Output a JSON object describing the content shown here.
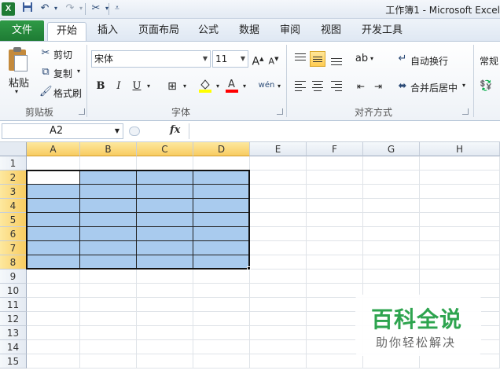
{
  "window": {
    "title": "工作簿1 - Microsoft Excel"
  },
  "quick_access": {
    "icons": [
      "excel-logo-icon",
      "save-icon",
      "undo-icon",
      "redo-icon",
      "tools-icon",
      "customize-icon"
    ]
  },
  "tabs": [
    {
      "label": "文件"
    },
    {
      "label": "开始"
    },
    {
      "label": "插入"
    },
    {
      "label": "页面布局"
    },
    {
      "label": "公式"
    },
    {
      "label": "数据"
    },
    {
      "label": "审阅"
    },
    {
      "label": "视图"
    },
    {
      "label": "开发工具"
    }
  ],
  "ribbon": {
    "clipboard": {
      "paste": "粘贴",
      "cut": "剪切",
      "copy": "复制",
      "format_painter": "格式刷",
      "group": "剪贴板"
    },
    "font": {
      "font_name": "宋体",
      "font_size": "11",
      "bold": "B",
      "italic": "I",
      "underline": "U",
      "group": "字体",
      "fill_color": "#ffff00",
      "font_color": "#ff0000"
    },
    "alignment": {
      "wrap_text": "自动换行",
      "merge_center": "合并后居中",
      "group": "对齐方式"
    },
    "number": {
      "format": "常规"
    }
  },
  "formula_bar": {
    "name_box": "A2",
    "fx": "fx",
    "formula": ""
  },
  "grid": {
    "columns": [
      "A",
      "B",
      "C",
      "D",
      "E",
      "F",
      "G",
      "H"
    ],
    "rows": [
      "1",
      "2",
      "3",
      "4",
      "5",
      "6",
      "7",
      "8",
      "9",
      "10",
      "11",
      "12",
      "13",
      "14",
      "15"
    ],
    "selected_columns": [
      "A",
      "B",
      "C",
      "D"
    ],
    "selected_rows": [
      "2",
      "3",
      "4",
      "5",
      "6",
      "7",
      "8"
    ],
    "selection": "A2:D8",
    "active_cell": "A2",
    "highlight_color": "#a9cbee"
  },
  "watermark": {
    "title": "百科全说",
    "subtitle": "助你轻松解决"
  }
}
